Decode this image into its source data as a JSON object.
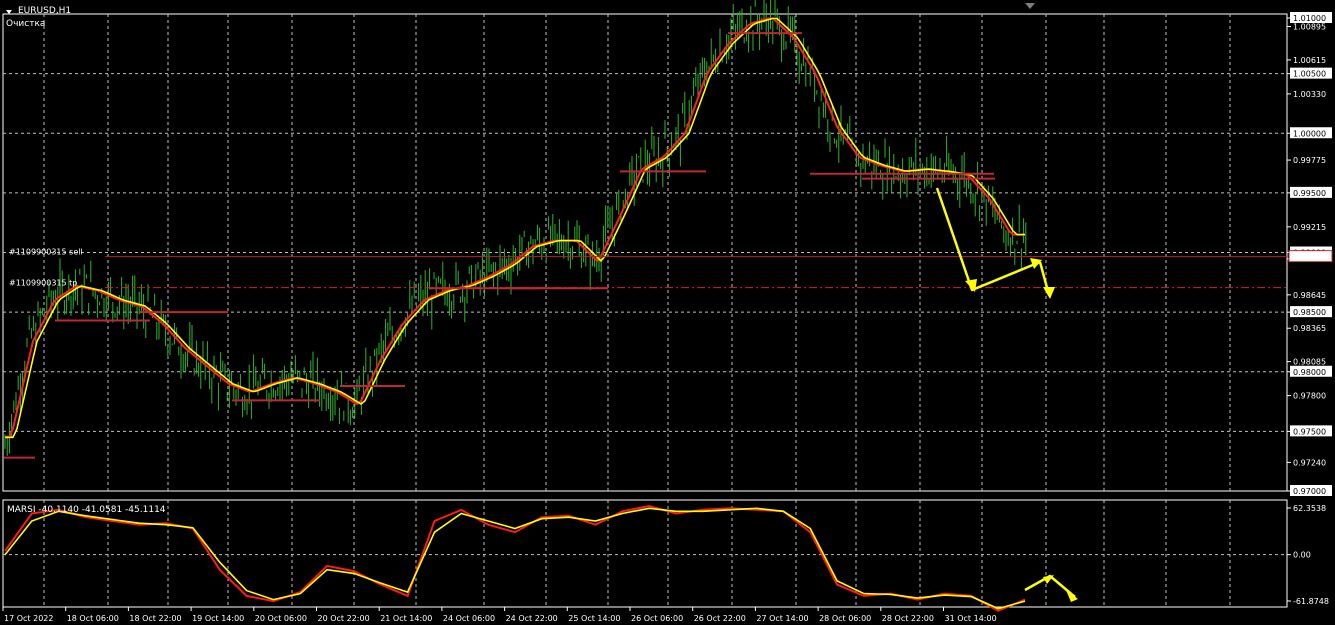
{
  "window": {
    "symbol_title": "EURUSD,H1",
    "comment": "Очистка"
  },
  "indicator": {
    "label": "MARSI -40.1140 -41.0581 -45.1114"
  },
  "chart_data": [
    {
      "type": "line",
      "title": "EURUSD,H1",
      "series": [
        {
          "name": "",
          "values": [
            0.9745,
            0.9825,
            0.986,
            0.9872,
            0.9868,
            0.986,
            0.9855,
            0.984,
            0.982,
            0.9805,
            0.979,
            0.9783,
            0.979,
            0.9795,
            0.979,
            0.9783,
            0.9772,
            0.981,
            0.984,
            0.986,
            0.9868,
            0.9872,
            0.988,
            0.989,
            0.9905,
            0.991,
            0.991,
            0.9892,
            0.993,
            0.997,
            0.998,
            1.0,
            1.005,
            1.0075,
            1.0092,
            1.0097,
            1.008,
            1.005,
            1.0005,
            0.998,
            0.9973,
            0.9968,
            0.997,
            0.9968,
            0.9965,
            0.9945,
            0.9915,
            0.9915
          ]
        }
      ],
      "overlays": [
        {
          "name": "",
          "color": "#ff2020"
        },
        {
          "name": "",
          "color": "#ffff00"
        }
      ],
      "ylim": [
        0.97,
        1.01
      ],
      "y_ticks": [
        "1.01000",
        "1.00895",
        "1.00615",
        "1.00500",
        "1.00330",
        "1.00000",
        "0.99775",
        "0.99500",
        "0.99215",
        "0.99000",
        "0.98947",
        "0.98645",
        "0.98500",
        "0.98365",
        "0.98085",
        "0.98000",
        "0.97800",
        "0.97500",
        "0.97240",
        "0.97000"
      ],
      "y_tick_values": [
        1.01,
        1.00895,
        1.00615,
        1.005,
        1.0033,
        1.0,
        0.99775,
        0.995,
        0.99215,
        0.99,
        0.98947,
        0.98645,
        0.985,
        0.98365,
        0.98085,
        0.98,
        0.978,
        0.975,
        0.9724,
        0.97
      ],
      "highlighted_ticks": [
        "1.01000",
        "1.00500",
        "1.00000",
        "0.99500",
        "0.99000",
        "0.98500",
        "0.98000",
        "0.97500",
        "0.97000"
      ],
      "x_ticks": [
        "17 Oct 2022",
        "18 Oct 06:00",
        "18 Oct 22:00",
        "19 Oct 14:00",
        "20 Oct 06:00",
        "20 Oct 22:00",
        "21 Oct 14:00",
        "24 Oct 06:00",
        "24 Oct 22:00",
        "25 Oct 14:00",
        "26 Oct 06:00",
        "26 Oct 22:00",
        "27 Oct 14:00",
        "28 Oct 06:00",
        "28 Oct 22:00",
        "31 Oct 14:00"
      ],
      "levels": [
        {
          "label": "#1109900315 sell",
          "value": 0.98965,
          "style": "solid",
          "color": "#b22222"
        },
        {
          "label": "#1109900315 tp",
          "value": 0.98705,
          "style": "dash-dot",
          "color": "#d42020"
        }
      ],
      "grid": true,
      "bar_color": "#2fb52f"
    },
    {
      "type": "line",
      "title": "MARSI",
      "series": [
        {
          "name": "",
          "values": [
            5,
            55,
            60,
            50,
            45,
            40,
            42,
            35,
            -20,
            -55,
            -62,
            -50,
            -15,
            -22,
            -40,
            -55,
            45,
            60,
            40,
            30,
            50,
            52,
            40,
            58,
            65,
            55,
            60,
            62,
            60,
            58,
            30,
            -40,
            -55,
            -52,
            -60,
            -52,
            -55,
            -75,
            -60
          ]
        },
        {
          "name": "",
          "values": [
            0,
            45,
            58,
            52,
            47,
            42,
            40,
            36,
            -10,
            -48,
            -60,
            -52,
            -20,
            -25,
            -38,
            -50,
            30,
            55,
            45,
            35,
            48,
            50,
            45,
            55,
            62,
            58,
            58,
            60,
            62,
            58,
            35,
            -35,
            -52,
            -53,
            -58,
            -54,
            -56,
            -72,
            -62
          ]
        }
      ],
      "values_printed": [
        -40.114,
        -41.0581,
        -45.1114
      ],
      "y_ticks": [
        "62.3538",
        "0.00",
        "-61.8748"
      ],
      "y_tick_values": [
        62.3538,
        0,
        -61.8748
      ]
    }
  ]
}
